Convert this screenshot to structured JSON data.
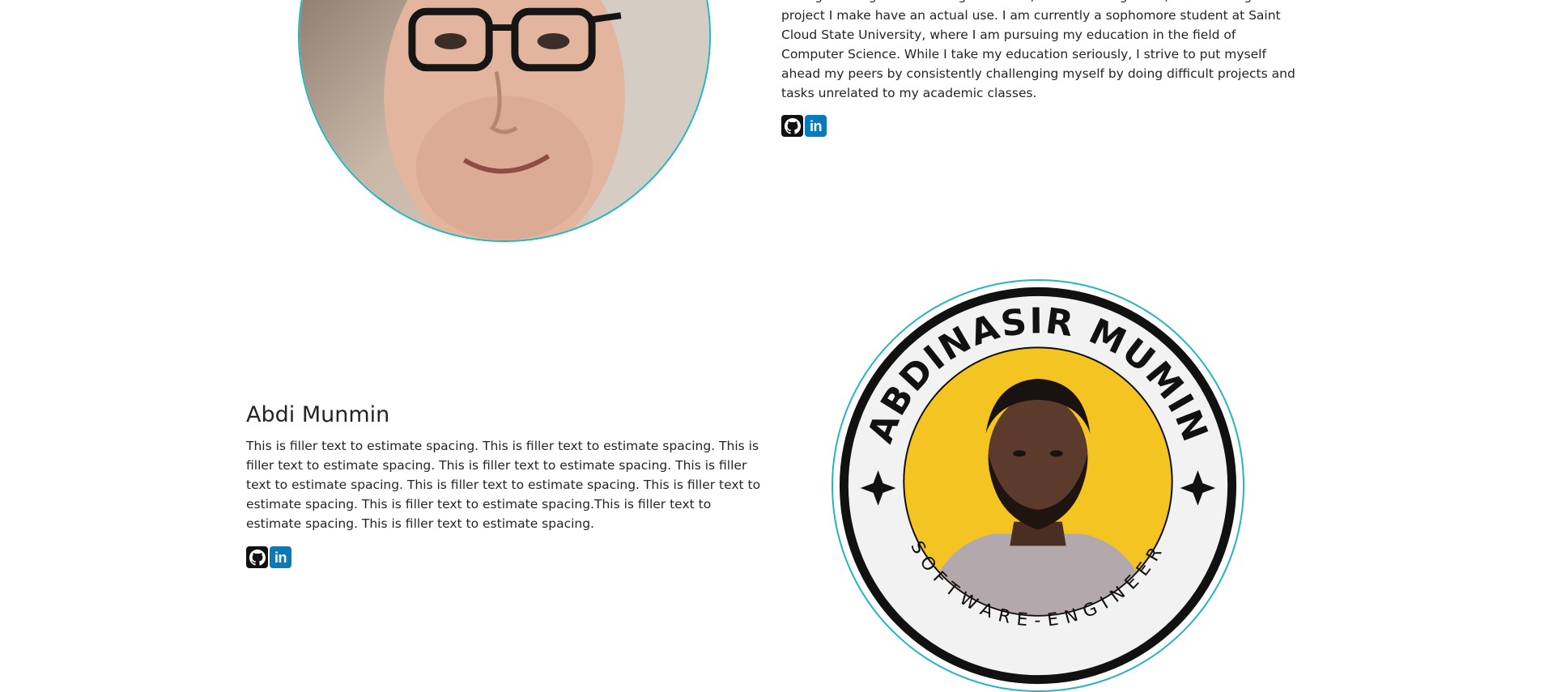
{
  "members": [
    {
      "bio_fragment": "through coding. From making a website, to automating tasks, I love seeing a project I make have an actual use. I am currently a sophomore student at Saint Cloud State University, where I am pursuing my education in the field of Computer Science. While I take my education seriously, I strive to put myself ahead my peers by consistently challenging myself by doing difficult projects and tasks unrelated to my academic classes.",
      "links": {
        "github": "github-icon",
        "linkedin": "linkedin-icon"
      }
    },
    {
      "name": "Abdi Munmin",
      "bio": "This is filler text to estimate spacing. This is filler text to estimate spacing. This is filler text to estimate spacing. This is filler text to estimate spacing. This is filler text to estimate spacing. This is filler text to estimate spacing. This is filler text to estimate spacing. This is filler text to estimate spacing.This is filler text to estimate spacing. This is filler text to estimate spacing.",
      "badge": {
        "name": "ABDINASIR MUMIN",
        "title": "SOFTWARE-ENGINEER"
      },
      "links": {
        "github": "github-icon",
        "linkedin": "linkedin-icon"
      }
    }
  ],
  "colors": {
    "accent_border": "#1fb5c4",
    "github_bg": "#111111",
    "linkedin_bg": "#0a7ab8",
    "badge_yellow": "#f4c522"
  },
  "icons": {
    "linkedin_glyph": "in"
  }
}
